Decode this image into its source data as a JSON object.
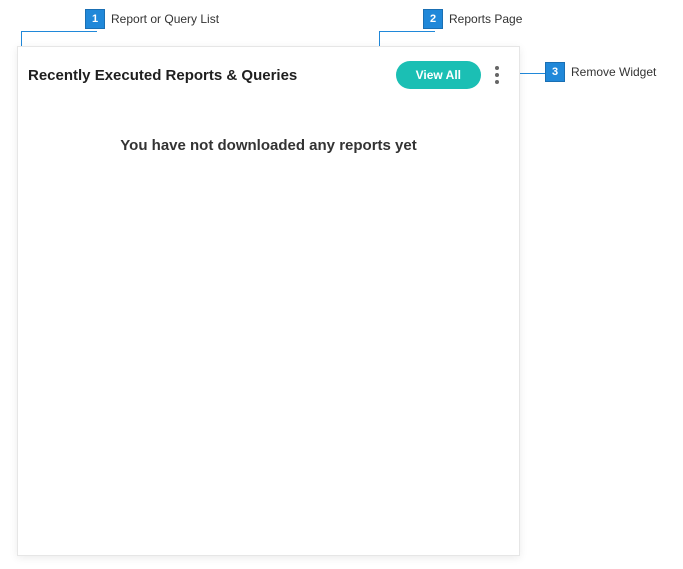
{
  "callouts": {
    "c1": {
      "num": "1",
      "label": "Report or Query List"
    },
    "c2": {
      "num": "2",
      "label": "Reports Page"
    },
    "c3": {
      "num": "3",
      "label": "Remove Widget"
    }
  },
  "widget": {
    "title": "Recently Executed Reports & Queries",
    "view_all_label": "View All",
    "empty_message": "You have not downloaded any reports yet"
  }
}
